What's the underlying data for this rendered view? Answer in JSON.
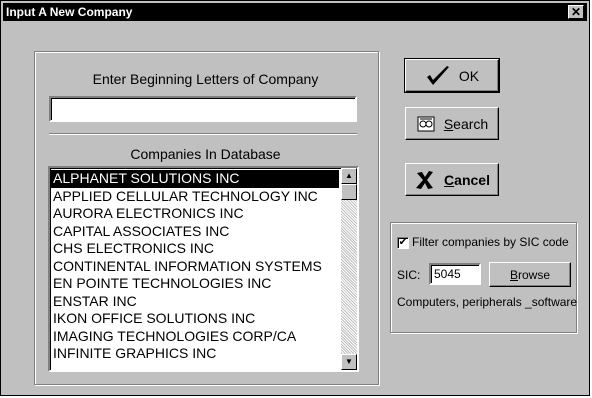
{
  "window": {
    "title": "Input A New Company",
    "close_symbol": "✕"
  },
  "search": {
    "label": "Enter Beginning Letters of Company",
    "value": "",
    "placeholder": ""
  },
  "companies": {
    "label": "Companies In Database",
    "items": [
      "ALPHANET SOLUTIONS INC",
      "APPLIED CELLULAR TECHNOLOGY INC",
      "AURORA ELECTRONICS INC",
      "CAPITAL ASSOCIATES INC",
      "CHS ELECTRONICS INC",
      "CONTINENTAL INFORMATION SYSTEMS",
      "EN POINTE TECHNOLOGIES INC",
      "ENSTAR INC",
      "IKON OFFICE SOLUTIONS INC",
      "IMAGING TECHNOLOGIES CORP/CA",
      "INFINITE GRAPHICS INC"
    ],
    "selected_index": 0
  },
  "buttons": {
    "ok": "OK",
    "search": "Search",
    "cancel": "Cancel"
  },
  "sic": {
    "filter_label": "Filter companies by SIC code",
    "filter_checked": true,
    "sic_label": "SIC:",
    "sic_value": "5045",
    "browse_label": "Browse",
    "description": "Computers, peripherals _software"
  },
  "icons": {
    "ok": "checkmark-icon",
    "search": "binoculars-icon",
    "cancel": "x-icon"
  }
}
